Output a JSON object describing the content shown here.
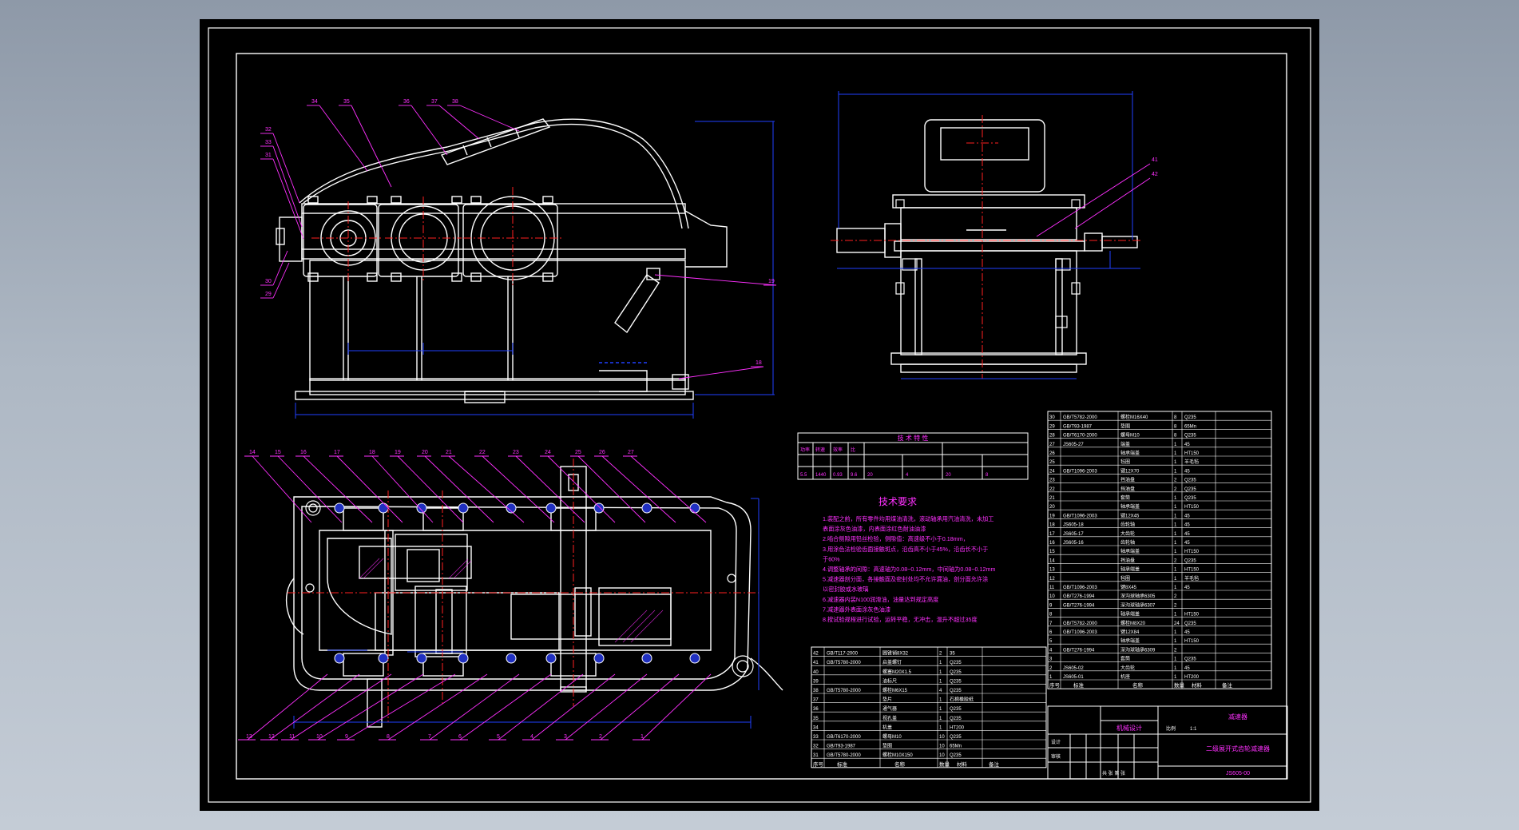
{
  "colors": {
    "background": "#a9b3bf",
    "sheet": "#000000",
    "line": "#ffffff",
    "centerline": "#ff2020",
    "dimension": "#2040ff",
    "leader": "#ff30ff",
    "annotation_text": "#ff30ff"
  },
  "views": {
    "front": {
      "leader_labels": [
        "34",
        "35",
        "36",
        "37",
        "38",
        "32",
        "33",
        "31",
        "30",
        "29",
        "19",
        "18"
      ]
    },
    "side": {
      "leader_labels": [
        "41",
        "42"
      ]
    },
    "top": {
      "leader_labels_top": [
        "14",
        "15",
        "16",
        "17",
        "18",
        "19",
        "20",
        "21",
        "22",
        "23",
        "24",
        "25",
        "26",
        "27"
      ],
      "leader_labels_bottom": [
        "13",
        "12",
        "11",
        "10",
        "9",
        "8",
        "7",
        "6",
        "5",
        "4",
        "3",
        "2",
        "1"
      ]
    }
  },
  "spec_table": {
    "title": "技 术 特 性"
  },
  "tech_notes": {
    "title": "技术要求",
    "lines": [
      "1.装配之前，所有零件均用煤油清洗，滚动轴承用汽油清洗，未加工",
      "表面涂灰色油漆，内表面涂红色耐油油漆",
      "2.啮合侧隙用铅丝检验，侧隙值：高速级不小于0.18mm，",
      "3.用涂色法检验齿面接触斑点，沿齿高不小于45%，沿齿长不小于",
      "于60%",
      "4.调整轴承的间隙：高速轴为0.08~0.12mm，中间轴为0.08~0.12mm",
      "5.减速器剖分面，各接触面及密封处均不允许漏油，剖分面允许涂",
      "以密封胶或水玻璃",
      "6.减速器内装N100润滑油，油量达到规定高度",
      "7.减速器外表面涂灰色油漆",
      "8.按试验规程进行试验，运转平稳，无冲击，温升不超过35度"
    ]
  },
  "parts_right": [
    {
      "no": "30",
      "std": "GB/T5782-2000",
      "name": "螺栓M16X40",
      "qty": "8",
      "mat": "Q235"
    },
    {
      "no": "29",
      "std": "GB/T93-1987",
      "name": "垫圈",
      "qty": "8",
      "mat": "65Mn"
    },
    {
      "no": "28",
      "std": "GB/T6170-2000",
      "name": "螺母M10",
      "qty": "8",
      "mat": "Q235"
    },
    {
      "no": "27",
      "std": "JS605-27",
      "name": "端盖",
      "qty": "1",
      "mat": "45"
    },
    {
      "no": "26",
      "std": "",
      "name": "轴承端盖",
      "qty": "1",
      "mat": "HT150"
    },
    {
      "no": "25",
      "std": "",
      "name": "毡圈",
      "qty": "1",
      "mat": "羊毛毡"
    },
    {
      "no": "24",
      "std": "GB/T1096-2003",
      "name": "键12X70",
      "qty": "1",
      "mat": "45"
    },
    {
      "no": "23",
      "std": "",
      "name": "挡油盘",
      "qty": "2",
      "mat": "Q235"
    },
    {
      "no": "22",
      "std": "",
      "name": "挡油盘",
      "qty": "2",
      "mat": "Q235"
    },
    {
      "no": "21",
      "std": "",
      "name": "套筒",
      "qty": "1",
      "mat": "Q235"
    },
    {
      "no": "20",
      "std": "",
      "name": "轴承端盖",
      "qty": "1",
      "mat": "HT150"
    },
    {
      "no": "19",
      "std": "GB/T1096-2003",
      "name": "键12X45",
      "qty": "1",
      "mat": "45"
    },
    {
      "no": "18",
      "std": "JS605-18",
      "name": "齿轮轴",
      "qty": "1",
      "mat": "45"
    },
    {
      "no": "17",
      "std": "JS605-17",
      "name": "大齿轮",
      "qty": "1",
      "mat": "45"
    },
    {
      "no": "16",
      "std": "JS605-16",
      "name": "齿轮轴",
      "qty": "1",
      "mat": "45"
    },
    {
      "no": "15",
      "std": "",
      "name": "轴承端盖",
      "qty": "1",
      "mat": "HT150"
    },
    {
      "no": "14",
      "std": "",
      "name": "挡油盘",
      "qty": "2",
      "mat": "Q235"
    },
    {
      "no": "13",
      "std": "",
      "name": "轴承端盖",
      "qty": "1",
      "mat": "HT150"
    },
    {
      "no": "12",
      "std": "",
      "name": "毡圈",
      "qty": "1",
      "mat": "羊毛毡"
    },
    {
      "no": "11",
      "std": "GB/T1096-2003",
      "name": "键8X45",
      "qty": "1",
      "mat": "45"
    },
    {
      "no": "10",
      "std": "GB/T276-1994",
      "name": "深沟球轴承6305",
      "qty": "2",
      "mat": ""
    },
    {
      "no": "9",
      "std": "GB/T276-1994",
      "name": "深沟球轴承6307",
      "qty": "2",
      "mat": ""
    },
    {
      "no": "8",
      "std": "",
      "name": "轴承端盖",
      "qty": "1",
      "mat": "HT150"
    },
    {
      "no": "7",
      "std": "GB/T5782-2000",
      "name": "螺栓M8X20",
      "qty": "24",
      "mat": "Q235"
    },
    {
      "no": "6",
      "std": "GB/T1096-2003",
      "name": "键12X84",
      "qty": "1",
      "mat": "45"
    },
    {
      "no": "5",
      "std": "",
      "name": "轴承端盖",
      "qty": "1",
      "mat": "HT150"
    },
    {
      "no": "4",
      "std": "GB/T276-1994",
      "name": "深沟球轴承6309",
      "qty": "2",
      "mat": ""
    },
    {
      "no": "3",
      "std": "",
      "name": "套筒",
      "qty": "1",
      "mat": "Q235"
    },
    {
      "no": "2",
      "std": "JS605-02",
      "name": "大齿轮",
      "qty": "1",
      "mat": "45"
    },
    {
      "no": "1",
      "std": "JS605-01",
      "name": "机座",
      "qty": "1",
      "mat": "HT200"
    }
  ],
  "parts_left": [
    {
      "no": "42",
      "std": "GB/T117-2000",
      "name": "圆锥销8X32",
      "qty": "2",
      "mat": "35"
    },
    {
      "no": "41",
      "std": "GB/T5780-2000",
      "name": "启盖螺钉",
      "qty": "1",
      "mat": "Q235"
    },
    {
      "no": "40",
      "std": "",
      "name": "螺塞M20X1.5",
      "qty": "1",
      "mat": "Q235"
    },
    {
      "no": "39",
      "std": "",
      "name": "油标尺",
      "qty": "1",
      "mat": "Q235"
    },
    {
      "no": "38",
      "std": "GB/T5780-2000",
      "name": "螺栓M6X15",
      "qty": "4",
      "mat": "Q235"
    },
    {
      "no": "37",
      "std": "",
      "name": "垫片",
      "qty": "1",
      "mat": "石棉橡胶纸"
    },
    {
      "no": "36",
      "std": "",
      "name": "通气器",
      "qty": "1",
      "mat": "Q235"
    },
    {
      "no": "35",
      "std": "",
      "name": "视孔盖",
      "qty": "1",
      "mat": "Q235"
    },
    {
      "no": "34",
      "std": "",
      "name": "机盖",
      "qty": "1",
      "mat": "HT200"
    },
    {
      "no": "33",
      "std": "GB/T6170-2000",
      "name": "螺母M10",
      "qty": "10",
      "mat": "Q235"
    },
    {
      "no": "32",
      "std": "GB/T93-1987",
      "name": "垫圈",
      "qty": "10",
      "mat": "65Mn"
    },
    {
      "no": "31",
      "std": "GB/T5780-2000",
      "name": "螺栓M10X150",
      "qty": "10",
      "mat": "Q235"
    }
  ],
  "table_headers": {
    "no": "序号",
    "std": "标准",
    "name": "名称",
    "qty": "数量",
    "mat": "材料",
    "note": "备注"
  },
  "title_block": {
    "drawing_title": "二级展开式齿轮减速器",
    "drawing_no": "JS605-00",
    "scale_label": "比例",
    "scale_value": "1:1",
    "design_label": "设计",
    "check_label": "审核",
    "sheet_label": "共 张 第 张",
    "org": "机械设计",
    "note_small": "减速器"
  }
}
